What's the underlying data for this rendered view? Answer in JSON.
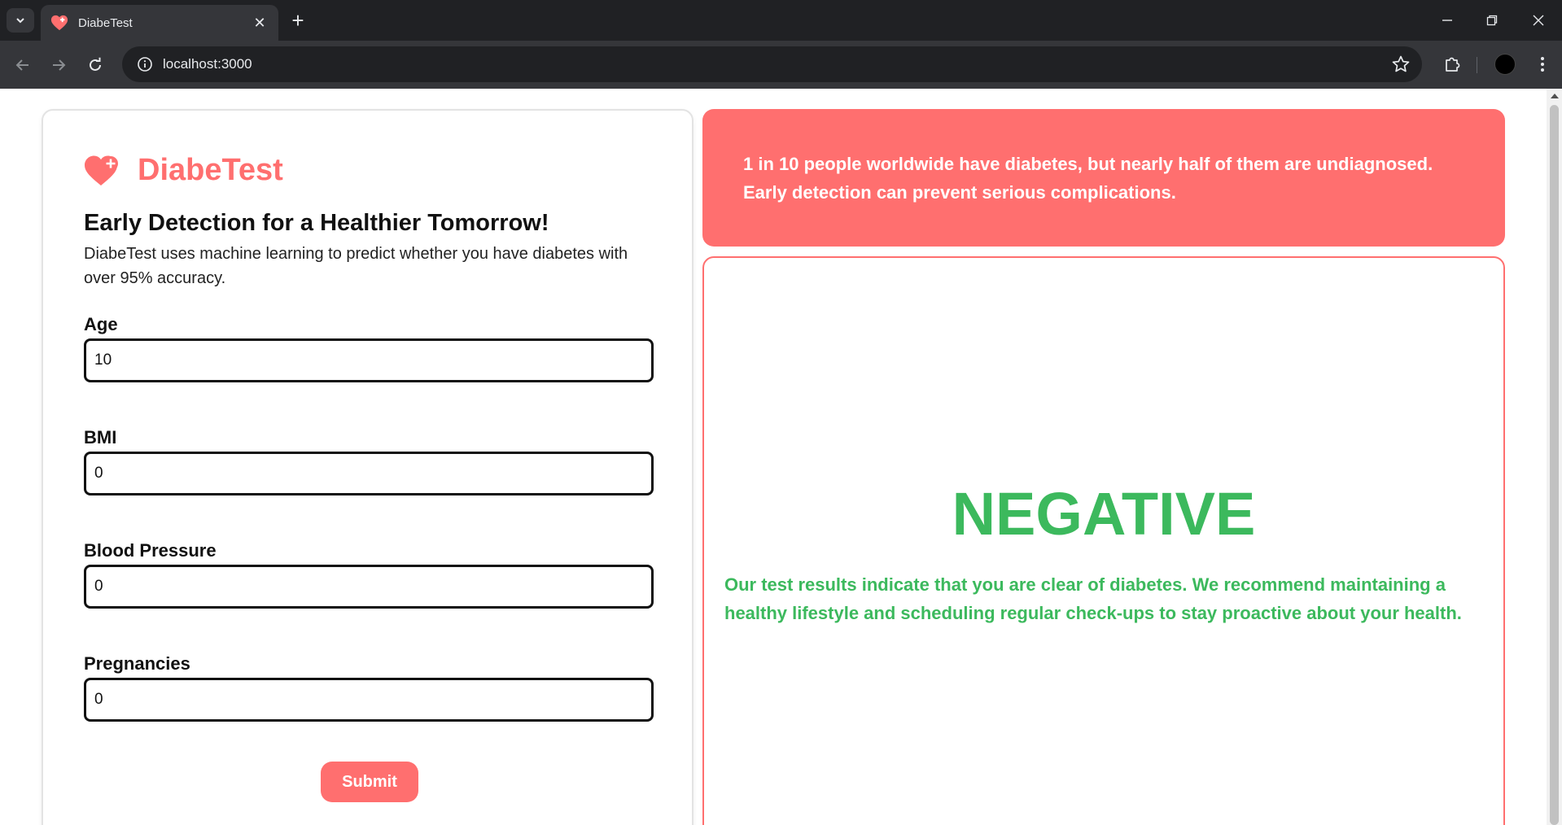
{
  "browser": {
    "tab_title": "DiabeTest",
    "url": "localhost:3000"
  },
  "brand": {
    "name": "DiabeTest",
    "accent_color": "#ff6f6f"
  },
  "intro": {
    "headline": "Early Detection for a Healthier Tomorrow!",
    "description": "DiabeTest uses machine learning to predict whether you have diabetes with over 95% accuracy."
  },
  "form": {
    "fields": [
      {
        "label": "Age",
        "value": "10"
      },
      {
        "label": "BMI",
        "value": "0"
      },
      {
        "label": "Blood Pressure",
        "value": "0"
      },
      {
        "label": "Pregnancies",
        "value": "0"
      }
    ],
    "submit_label": "Submit"
  },
  "banner": {
    "text": "1 in 10 people worldwide have diabetes, but nearly half of them are undiagnosed. Early detection can prevent serious complications."
  },
  "result": {
    "status": "NEGATIVE",
    "status_color": "#3cb95d",
    "message": "Our test results indicate that you are clear of diabetes. We recommend maintaining a healthy lifestyle and scheduling regular check-ups to stay proactive about your health."
  }
}
